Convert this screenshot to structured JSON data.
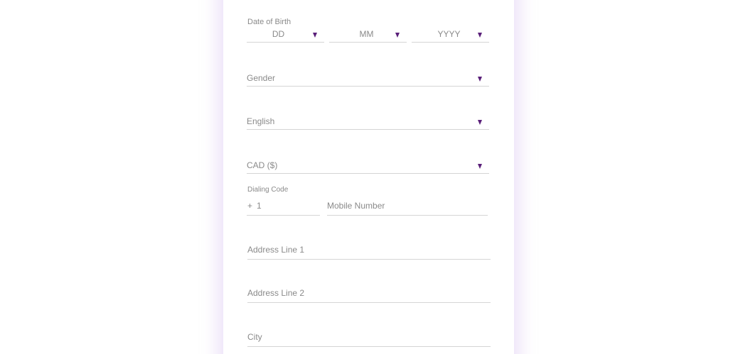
{
  "form": {
    "dob_label": "Date of Birth",
    "dob_day_placeholder": "DD",
    "dob_month_placeholder": "MM",
    "dob_year_placeholder": "YYYY",
    "gender_placeholder": "Gender",
    "language_value": "English",
    "currency_value": "CAD ($)",
    "dialing_code_label": "Dialing Code",
    "dialing_prefix": "+",
    "dialing_code_value": "1",
    "mobile_placeholder": "Mobile Number",
    "address1_placeholder": "Address Line 1",
    "address2_placeholder": "Address Line 2",
    "city_placeholder": "City"
  },
  "colors": {
    "caret": "#5a1f79",
    "placeholder_text": "#8a8a8a",
    "underline": "#d5d5d5",
    "card_glow": "#c8aaeb"
  },
  "icons": {
    "dropdown": "caret-down-icon"
  }
}
